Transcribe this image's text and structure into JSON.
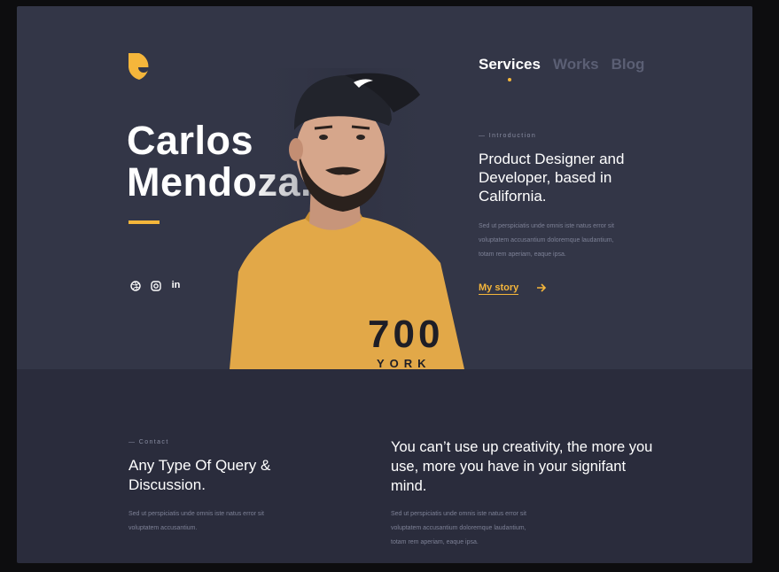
{
  "colors": {
    "accent": "#f5b63b",
    "hero_bg": "#333647",
    "lower_bg": "#2a2c3c"
  },
  "brand": {
    "logo": "logo-icon"
  },
  "hero": {
    "name_line1": "Carlos",
    "name_line2": "Mendoza."
  },
  "social": [
    {
      "icon": "dribbble-icon"
    },
    {
      "icon": "instagram-icon"
    },
    {
      "icon": "linkedin-icon",
      "label": "in"
    }
  ],
  "nav": {
    "items": [
      {
        "label": "Services",
        "active": true
      },
      {
        "label": "Works",
        "active": false
      },
      {
        "label": "Blog",
        "active": false
      }
    ]
  },
  "intro": {
    "label": "— Introduction",
    "title": "Product Designer and Developer, based in California.",
    "body_lines": [
      "Sed ut perspiciatis unde omnis iste natus error sit",
      "voluptatem accusantium doloremque laudantium,",
      "totam rem aperiam, eaque ipsa."
    ],
    "link_label": "My story",
    "link_icon": "arrow-right-icon"
  },
  "contact": {
    "label": "— Contact",
    "title": "Any Type Of Query & Discussion.",
    "body_lines": [
      "Sed ut perspiciatis unde omnis iste natus error sit",
      "voluptatem accusantium."
    ]
  },
  "quote": {
    "text": "You can’t use up creativity, the more you use, more you have in your signifant mind.",
    "body_lines": [
      "Sed ut perspiciatis unde omnis iste natus error sit",
      "voluptatem accusantium doloremque laudantium,",
      "totam rem aperiam, eaque ipsa."
    ]
  }
}
